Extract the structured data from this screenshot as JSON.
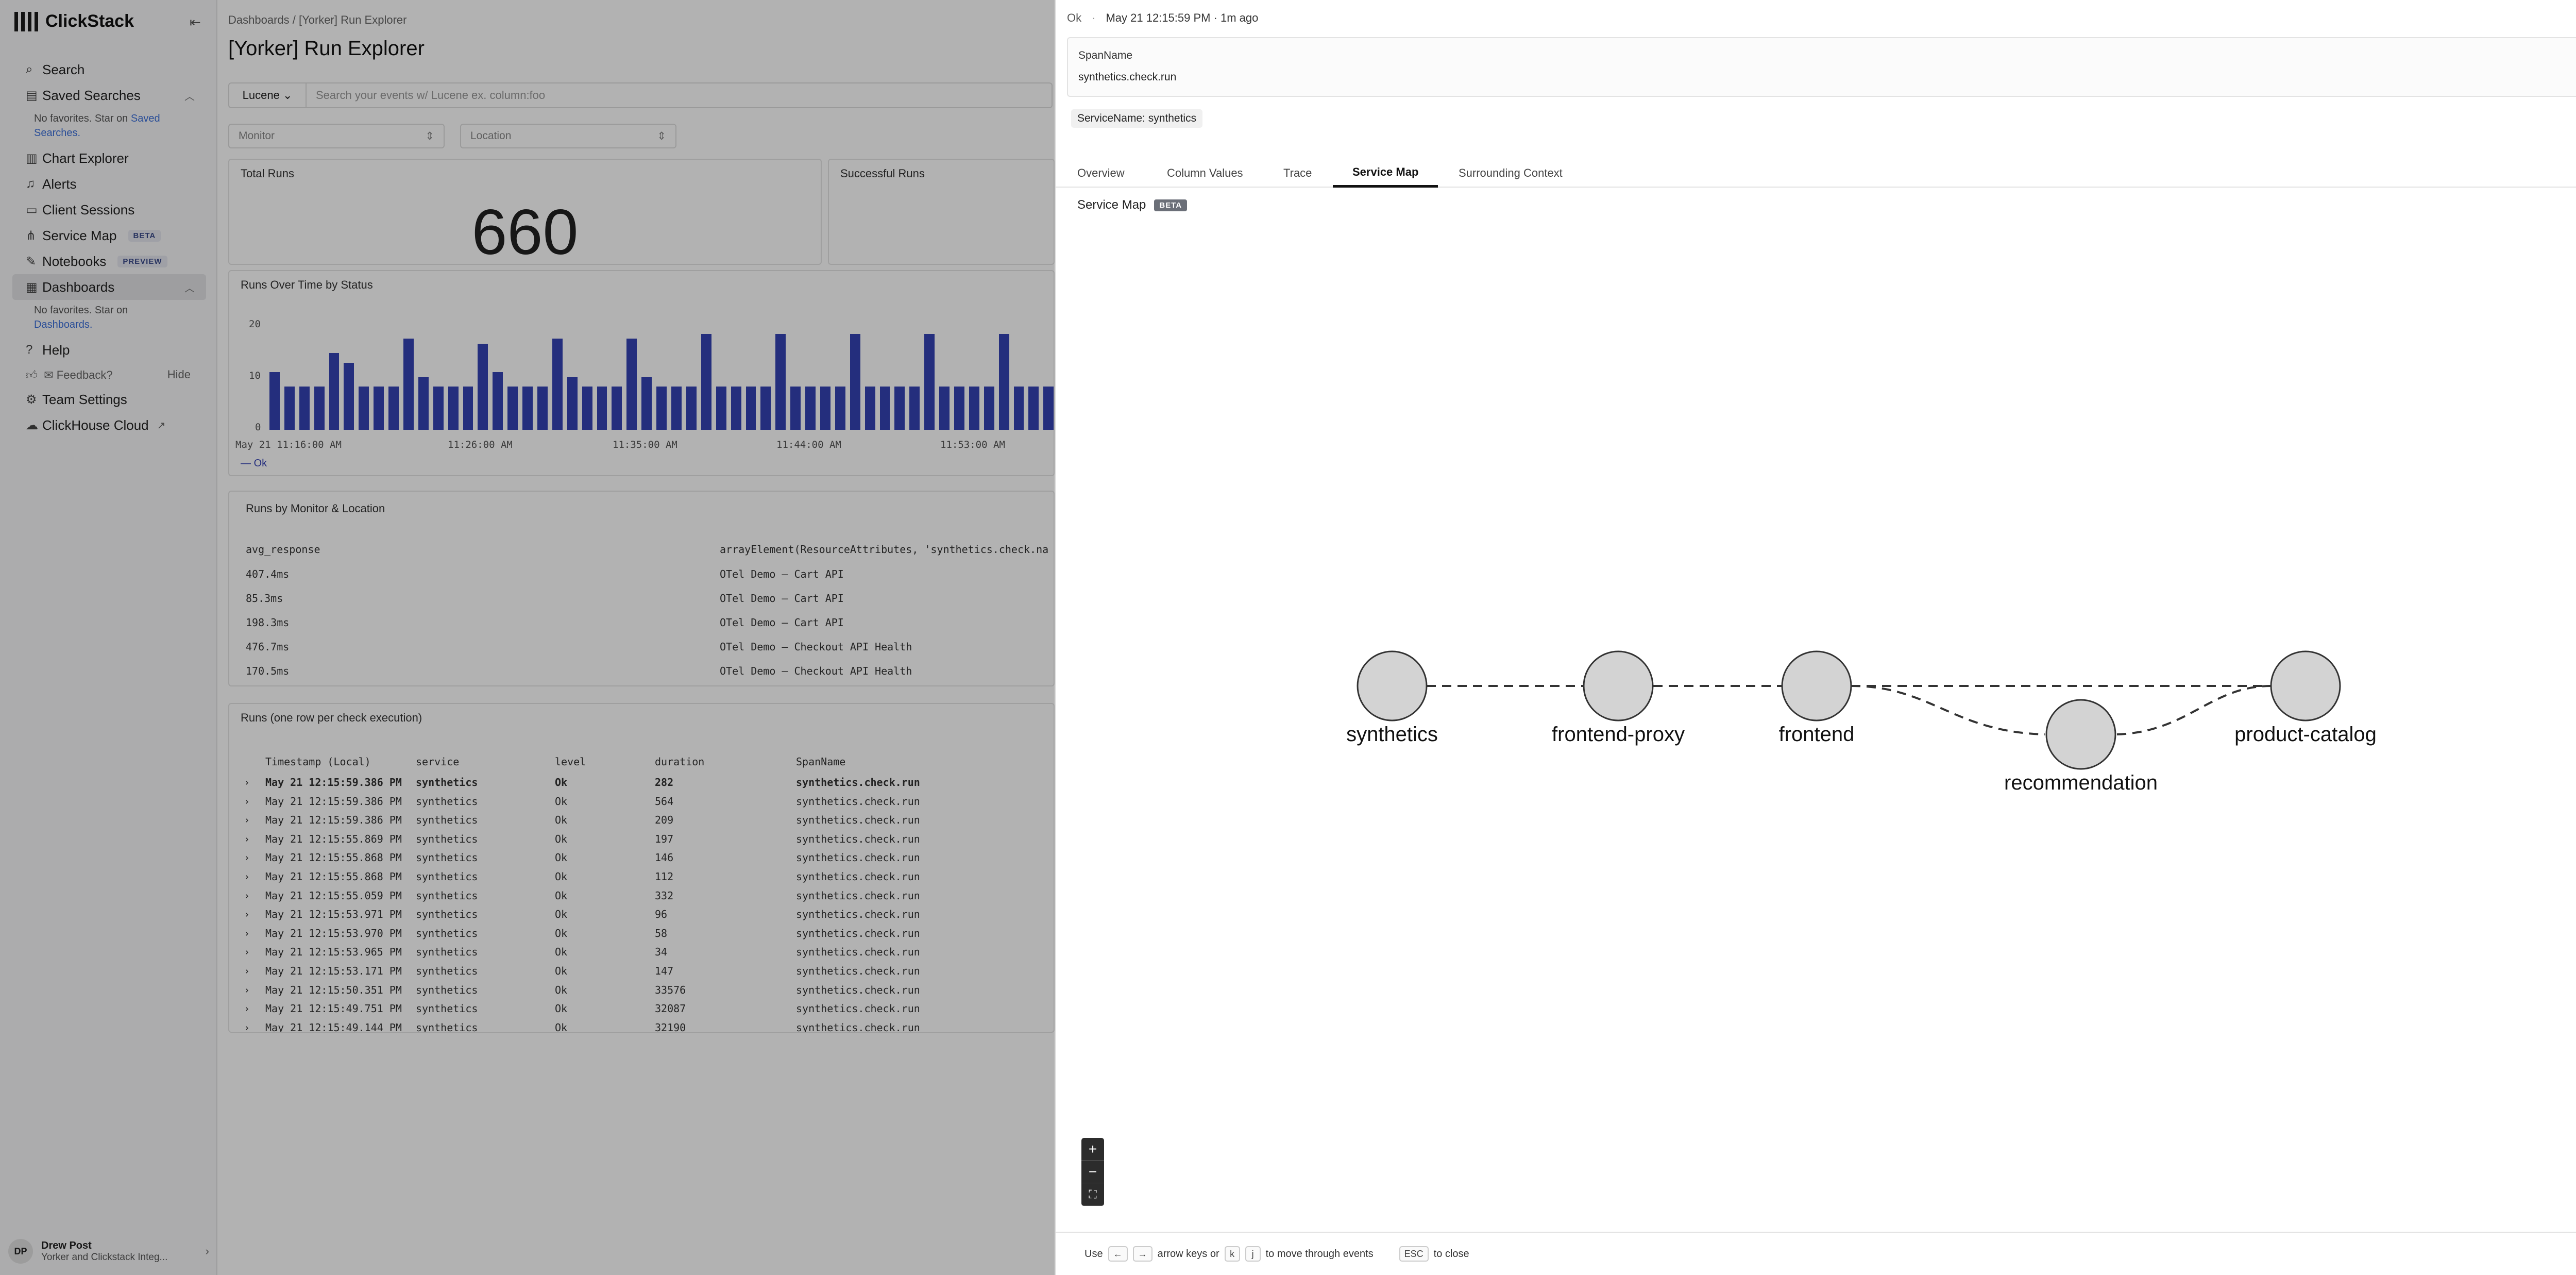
{
  "app": {
    "name": "ClickStack"
  },
  "sidebar": {
    "items": [
      {
        "label": "Search",
        "icon": "search-icon"
      },
      {
        "label": "Saved Searches",
        "icon": "bookmark-icon"
      },
      {
        "label": "Chart Explorer",
        "icon": "chart-icon"
      },
      {
        "label": "Alerts",
        "icon": "bell-icon"
      },
      {
        "label": "Client Sessions",
        "icon": "browser-icon"
      },
      {
        "label": "Service Map",
        "icon": "network-icon",
        "badge": "BETA"
      },
      {
        "label": "Notebooks",
        "icon": "notebook-icon",
        "badge": "PREVIEW"
      },
      {
        "label": "Dashboards",
        "icon": "grid-icon"
      },
      {
        "label": "Help",
        "icon": "help-icon"
      },
      {
        "label": "Team Settings",
        "icon": "gear-icon"
      },
      {
        "label": "ClickHouse Cloud",
        "icon": "cloud-icon"
      }
    ],
    "saved_note": "No favorites. Star on",
    "saved_link": "Saved Searches.",
    "dash_note": "No favorites. Star on",
    "dash_link": "Dashboards.",
    "feedback": "Feedback?",
    "hide": "Hide",
    "user": {
      "initials": "DP",
      "name": "Drew Post",
      "org": "Yorker and Clickstack Integ..."
    }
  },
  "dashboard": {
    "breadcrumb": "Dashboards  /  [Yorker] Run Explorer",
    "title": "[Yorker] Run Explorer",
    "query_lang": "Lucene",
    "query_placeholder": "Search your events w/ Lucene ex. column:foo",
    "filter_monitor": "Monitor",
    "filter_location": "Location",
    "total_runs_title": "Total Runs",
    "total_runs_value": "660",
    "successful_runs_title": "Successful Runs",
    "chart_title": "Runs Over Time by Status",
    "chart_legend": "Ok",
    "monitor_table_title": "Runs by Monitor & Location",
    "monitor_cols": [
      "avg_response",
      "arrayElement(ResourceAttributes, 'synthetics.check.na"
    ],
    "monitor_rows": [
      [
        "407.4ms",
        "OTel Demo — Cart API"
      ],
      [
        "85.3ms",
        "OTel Demo — Cart API"
      ],
      [
        "198.3ms",
        "OTel Demo — Cart API"
      ],
      [
        "476.7ms",
        "OTel Demo — Checkout API Health"
      ],
      [
        "170.5ms",
        "OTel Demo — Checkout API Health"
      ]
    ],
    "runs_table_title": "Runs (one row per check execution)",
    "runs_cols": [
      "Timestamp (Local)",
      "service",
      "level",
      "duration",
      "SpanName"
    ],
    "runs_rows": [
      [
        "May 21 12:15:59.386 PM",
        "synthetics",
        "Ok",
        "282",
        "synthetics.check.run"
      ],
      [
        "May 21 12:15:59.386 PM",
        "synthetics",
        "Ok",
        "564",
        "synthetics.check.run"
      ],
      [
        "May 21 12:15:59.386 PM",
        "synthetics",
        "Ok",
        "209",
        "synthetics.check.run"
      ],
      [
        "May 21 12:15:55.869 PM",
        "synthetics",
        "Ok",
        "197",
        "synthetics.check.run"
      ],
      [
        "May 21 12:15:55.868 PM",
        "synthetics",
        "Ok",
        "146",
        "synthetics.check.run"
      ],
      [
        "May 21 12:15:55.868 PM",
        "synthetics",
        "Ok",
        "112",
        "synthetics.check.run"
      ],
      [
        "May 21 12:15:55.059 PM",
        "synthetics",
        "Ok",
        "332",
        "synthetics.check.run"
      ],
      [
        "May 21 12:15:53.971 PM",
        "synthetics",
        "Ok",
        "96",
        "synthetics.check.run"
      ],
      [
        "May 21 12:15:53.970 PM",
        "synthetics",
        "Ok",
        "58",
        "synthetics.check.run"
      ],
      [
        "May 21 12:15:53.965 PM",
        "synthetics",
        "Ok",
        "34",
        "synthetics.check.run"
      ],
      [
        "May 21 12:15:53.171 PM",
        "synthetics",
        "Ok",
        "147",
        "synthetics.check.run"
      ],
      [
        "May 21 12:15:50.351 PM",
        "synthetics",
        "Ok",
        "33576",
        "synthetics.check.run"
      ],
      [
        "May 21 12:15:49.751 PM",
        "synthetics",
        "Ok",
        "32087",
        "synthetics.check.run"
      ],
      [
        "May 21 12:15:49.144 PM",
        "synthetics",
        "Ok",
        "32190",
        "synthetics.check.run"
      ]
    ],
    "chart_y_ticks": [
      "20",
      "10",
      "0"
    ],
    "chart_x_ticks": [
      "May 21 11:16:00 AM",
      "11:26:00 AM",
      "11:35:00 AM",
      "11:44:00 AM",
      "11:53:00 AM"
    ],
    "chart_values": [
      12,
      9,
      9,
      9,
      16,
      14,
      9,
      9,
      9,
      19,
      11,
      9,
      9,
      9,
      18,
      12,
      9,
      9,
      9,
      19,
      11,
      9,
      9,
      9,
      19,
      11,
      9,
      9,
      9,
      20,
      9,
      9,
      9,
      9,
      20,
      9,
      9,
      9,
      9,
      20,
      9,
      9,
      9,
      9,
      20,
      9,
      9,
      9,
      9,
      20,
      9,
      9,
      9
    ]
  },
  "drawer": {
    "status": "Ok",
    "timestamp": "May 21 12:15:59 PM · 1m ago",
    "span_label": "SpanName",
    "span_value": "synthetics.check.run",
    "service_chip": "ServiceName: synthetics",
    "tabs": [
      "Overview",
      "Column Values",
      "Trace",
      "Service Map",
      "Surrounding Context"
    ],
    "active_tab": "Service Map",
    "section_title": "Service Map",
    "section_badge": "BETA",
    "nodes": [
      "synthetics",
      "frontend-proxy",
      "frontend",
      "recommendation",
      "product-catalog"
    ],
    "footer": {
      "use": "Use",
      "arrow_left": "←",
      "arrow_right": "→",
      "mid": "arrow keys or",
      "k": "k",
      "j": "j",
      "move": "to move through events",
      "esc": "ESC",
      "close": "to close"
    }
  }
}
